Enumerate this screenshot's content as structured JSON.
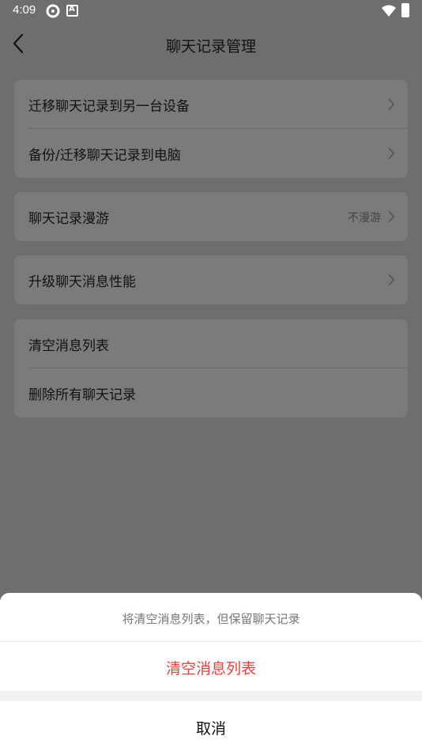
{
  "status_bar": {
    "time": "4:09"
  },
  "header": {
    "title": "聊天记录管理"
  },
  "cards": [
    {
      "items": [
        {
          "label": "迁移聊天记录到另一台设备"
        },
        {
          "label": "备份/迁移聊天记录到电脑"
        }
      ]
    },
    {
      "items": [
        {
          "label": "聊天记录漫游",
          "value": "不漫游"
        }
      ]
    },
    {
      "items": [
        {
          "label": "升级聊天消息性能"
        }
      ]
    },
    {
      "items": [
        {
          "label": "清空消息列表"
        },
        {
          "label": "删除所有聊天记录"
        }
      ]
    }
  ],
  "sheet": {
    "hint": "将清空消息列表，但保留聊天记录",
    "action": "清空消息列表",
    "cancel": "取消"
  },
  "colors": {
    "danger": "#e8443a",
    "overlay": "#6e6e6e"
  }
}
